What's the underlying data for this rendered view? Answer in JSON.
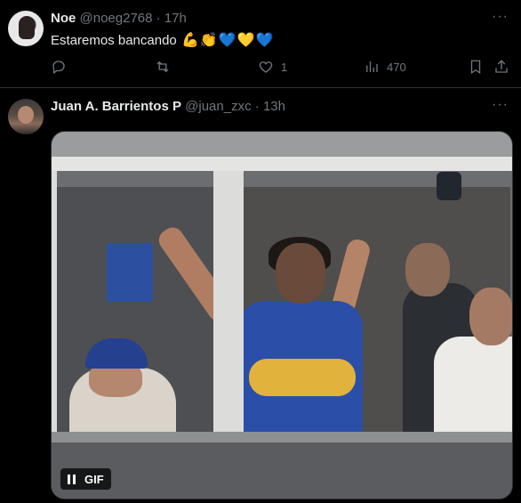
{
  "tweet1": {
    "name": "Noe",
    "handle": "@noeg2768",
    "separator": "·",
    "time": "17h",
    "text": "Estaremos bancando",
    "emojis": [
      "💪",
      "👏",
      "💙",
      "💛",
      "💙"
    ],
    "more": "···",
    "actions": {
      "reply_icon": "reply-icon",
      "retweet_icon": "retweet-icon",
      "like_icon": "heart-icon",
      "like_count": "1",
      "views_icon": "views-icon",
      "views_count": "470",
      "bookmark_icon": "bookmark-icon",
      "share_icon": "share-icon"
    }
  },
  "tweet2": {
    "name": "Juan A. Barrientos P",
    "handle": "@juan_zxc",
    "separator": "·",
    "time": "13h",
    "more": "···",
    "media": {
      "type": "gif",
      "badge": "GIF",
      "control_icon": "pause-icon"
    }
  },
  "colors": {
    "background": "#000000",
    "text_primary": "#e7e9ea",
    "text_secondary": "#71767b",
    "divider": "#2f3336"
  }
}
